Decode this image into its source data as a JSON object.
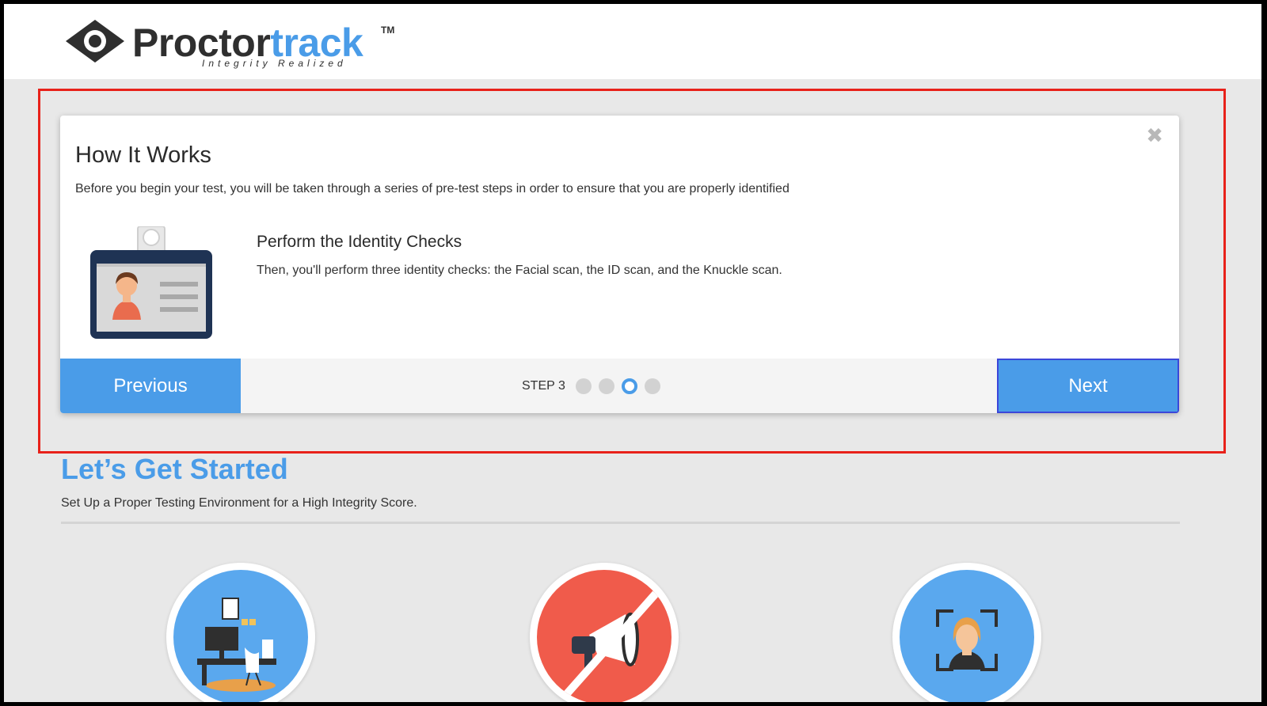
{
  "header": {
    "brand_part1": "Proctor",
    "brand_part2": "track",
    "trademark": "TM",
    "tagline": "Integrity Realized"
  },
  "modal": {
    "title": "How It Works",
    "subtitle": "Before you begin your test, you will be taken through a series of pre-test steps in order to ensure that you are properly identified",
    "close_icon": "close-icon",
    "step_title": "Perform the Identity Checks",
    "step_description": "Then, you'll perform three identity checks: the Facial scan, the ID scan, and the Knuckle scan.",
    "previous_label": "Previous",
    "next_label": "Next",
    "step_label": "STEP 3",
    "total_steps": 4,
    "current_step": 3
  },
  "main": {
    "title": "Let’s Get Started",
    "subtitle": "Set Up a Proper Testing Environment for a High Integrity Score.",
    "feature_icons": [
      "desk-workspace-icon",
      "no-noise-megaphone-icon",
      "face-scan-icon"
    ]
  },
  "colors": {
    "accent": "#4a9ce8",
    "highlight_border": "#e8211a",
    "noise_red": "#f05b4b"
  }
}
